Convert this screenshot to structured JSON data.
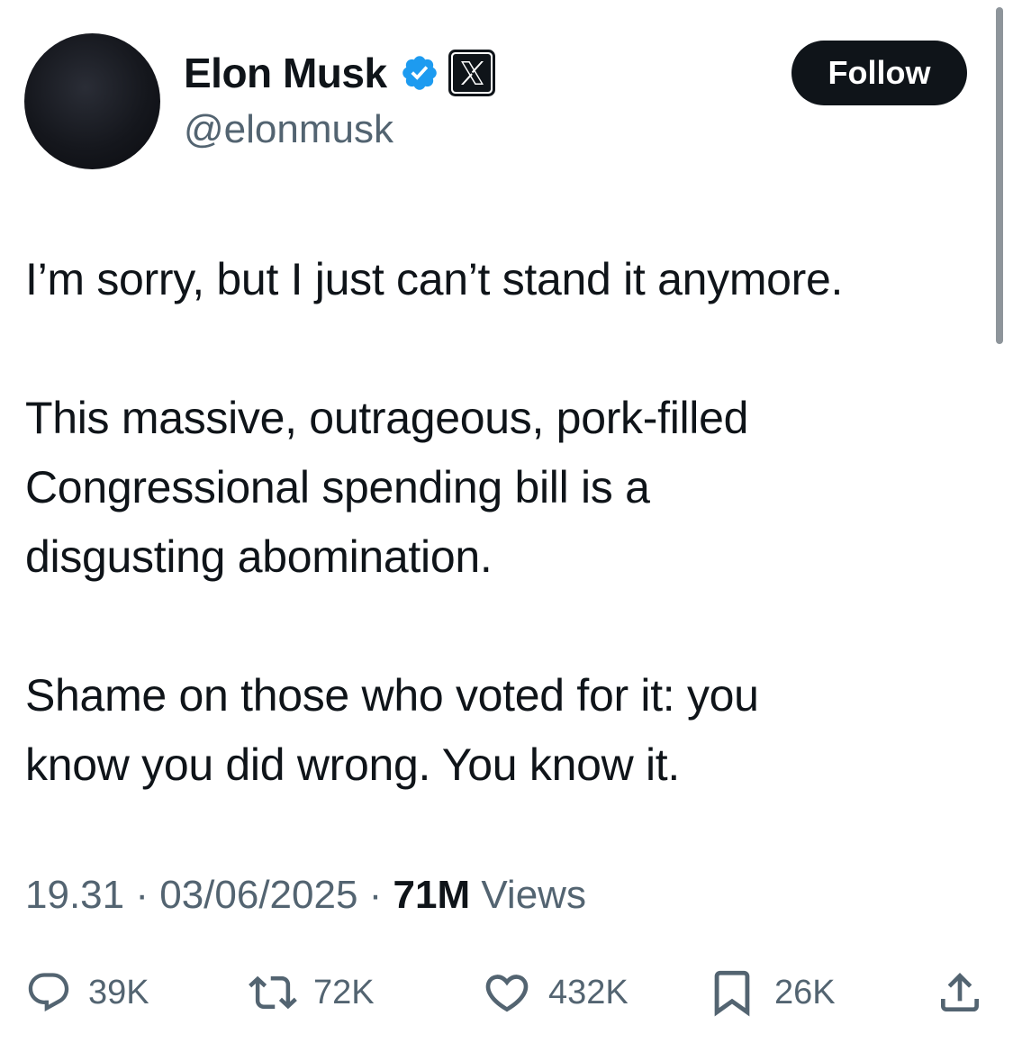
{
  "author": {
    "display_name": "Elon Musk",
    "handle": "@elonmusk",
    "verified_icon": "verified-badge-icon",
    "affiliate_icon": "x-logo-icon"
  },
  "follow_label": "Follow",
  "tweet": {
    "paragraphs": [
      "I’m sorry, but I just can’t stand it anymore.",
      "This massive, outrageous, pork-filled\nCongressional spending bill is a\ndisgusting abomination.",
      "Shame on those who voted for it: you\nknow you did wrong. You know it."
    ]
  },
  "meta": {
    "time": "19.31",
    "separator": " · ",
    "date": "03/06/2025",
    "views_count": "71M",
    "views_label": " Views"
  },
  "actions": {
    "replies": "39K",
    "reposts": "72K",
    "likes": "432K",
    "bookmarks": "26K"
  },
  "colors": {
    "text": "#0f1419",
    "secondary": "#536471",
    "verified_blue": "#1d9bf0",
    "button_bg": "#0f1419"
  }
}
